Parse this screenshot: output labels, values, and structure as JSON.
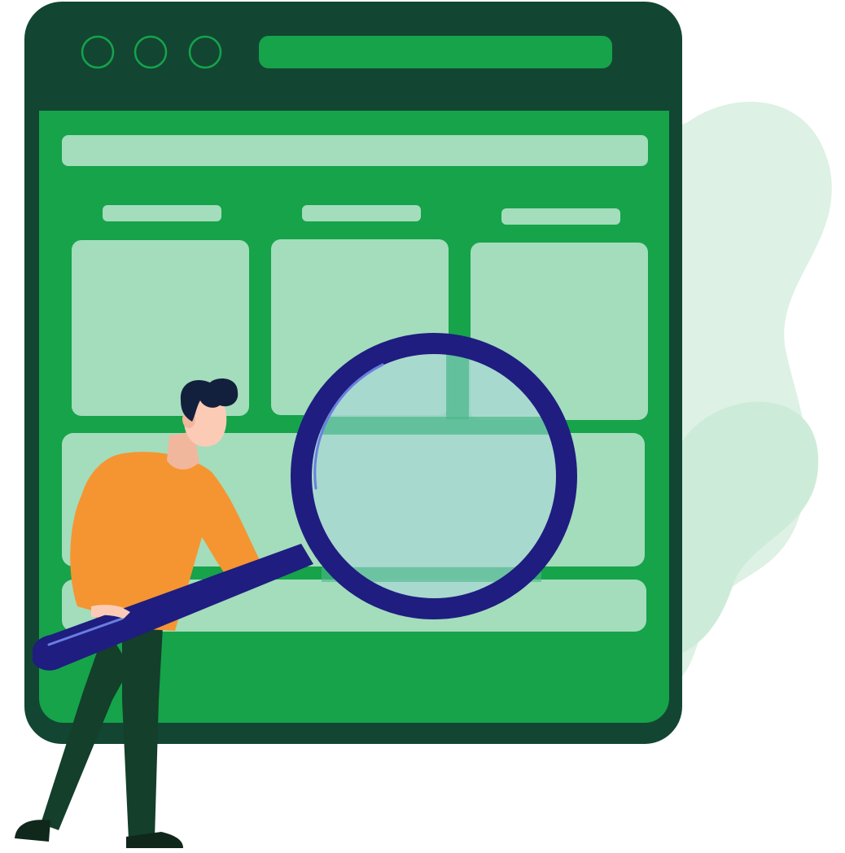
{
  "illustration": {
    "subject": "person-inspecting-web-page-with-magnifying-glass",
    "icons": {
      "window_dots": "window-control-dot-icon",
      "magnifier": "magnifying-glass-icon",
      "person": "person-figure"
    },
    "colors": {
      "frame_dark": "#124633",
      "page_green": "#16a34a",
      "placeholder_light": "#a3ddbc",
      "blob_light": "#ddf1e5",
      "blob_mid": "#cdebd9",
      "lens_rim": "#1f1d80",
      "lens_glass": "#a8d8cf",
      "shirt_orange": "#f59532",
      "skin": "#fbcbb6",
      "hair": "#13203d",
      "pants": "#133f2b"
    }
  }
}
